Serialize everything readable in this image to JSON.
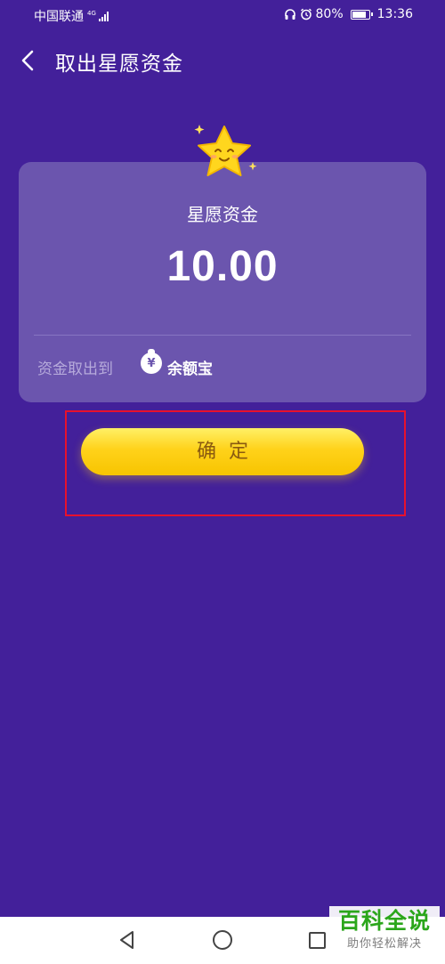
{
  "status_bar": {
    "carrier": "中国联通",
    "network": "4G",
    "battery": "80%",
    "time": "13:36"
  },
  "nav": {
    "title": "取出星愿资金"
  },
  "card": {
    "title": "星愿资金",
    "amount": "10.00",
    "dest_label": "资金取出到",
    "dest_icon_char": "¥",
    "dest_value": "余额宝"
  },
  "confirm_label": "确定",
  "watermark": {
    "main": "百科全说",
    "sub": "助你轻松解决"
  },
  "colors": {
    "background": "#43209a",
    "card": "#6b55ae",
    "button": "#ffd21a",
    "highlight": "#e8112d"
  }
}
